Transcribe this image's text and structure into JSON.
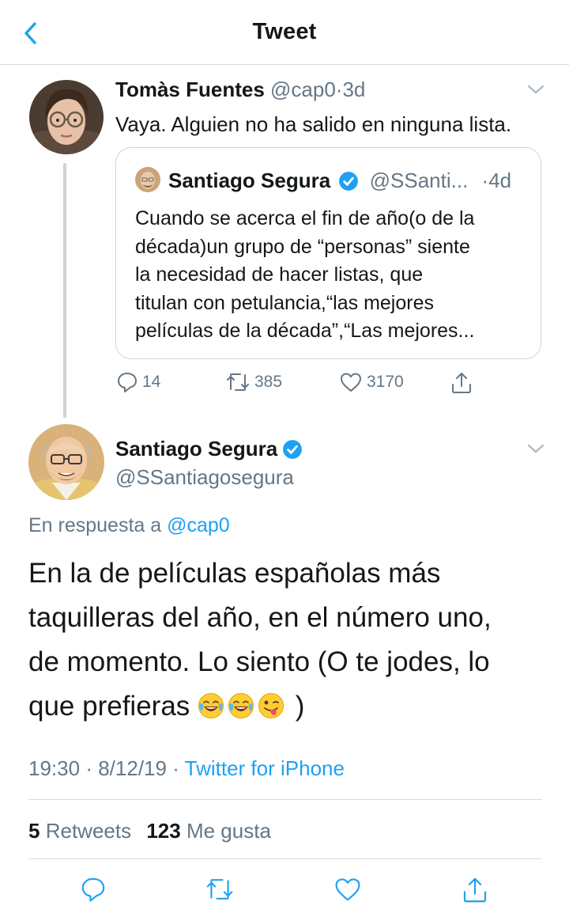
{
  "header": {
    "title": "Tweet",
    "back_icon": "chevron-left-icon"
  },
  "quoting_tweet": {
    "author_name": "Tomàs Fuentes",
    "author_handle": "@cap0",
    "separator": "·",
    "time": "3d",
    "text": "Vaya. Alguien no ha salido en ninguna lista.",
    "quoted": {
      "author_name": "Santiago Segura",
      "verified": true,
      "author_handle": "@SSanti...",
      "separator": "·",
      "time": "4d",
      "text_lines": [
        "Cuando se acerca el fin de año(o de la",
        "década)un grupo de “personas” siente",
        "la necesidad de hacer listas, que",
        "titulan con petulancia,“las mejores",
        "películas de la década”,“Las mejores..."
      ]
    },
    "actions": {
      "replies": "14",
      "retweets": "385",
      "likes": "3170"
    }
  },
  "main_tweet": {
    "author_name": "Santiago Segura",
    "verified": true,
    "author_handle": "@SSantiagosegura",
    "reply_prefix": "En respuesta a",
    "reply_handle": "@cap0",
    "text_lines": [
      "En la de películas españolas más",
      "taquilleras del año, en el número uno,",
      "de momento. Lo siento (O te jodes, lo"
    ],
    "text_last_line_start": "que prefieras",
    "text_last_line_end": ")",
    "emojis": [
      "joy-emoji",
      "joy-emoji",
      "winking-tongue-emoji"
    ],
    "time": "19:30",
    "separator": "·",
    "date": "8/12/19",
    "source": "Twitter for iPhone",
    "retweets_count": "5",
    "retweets_label": "Retweets",
    "likes_count": "123",
    "likes_label": "Me gusta"
  },
  "colors": {
    "accent": "#1da1f2",
    "muted": "#657786",
    "verified": "#1da1f2",
    "divider": "#d6dadd"
  }
}
